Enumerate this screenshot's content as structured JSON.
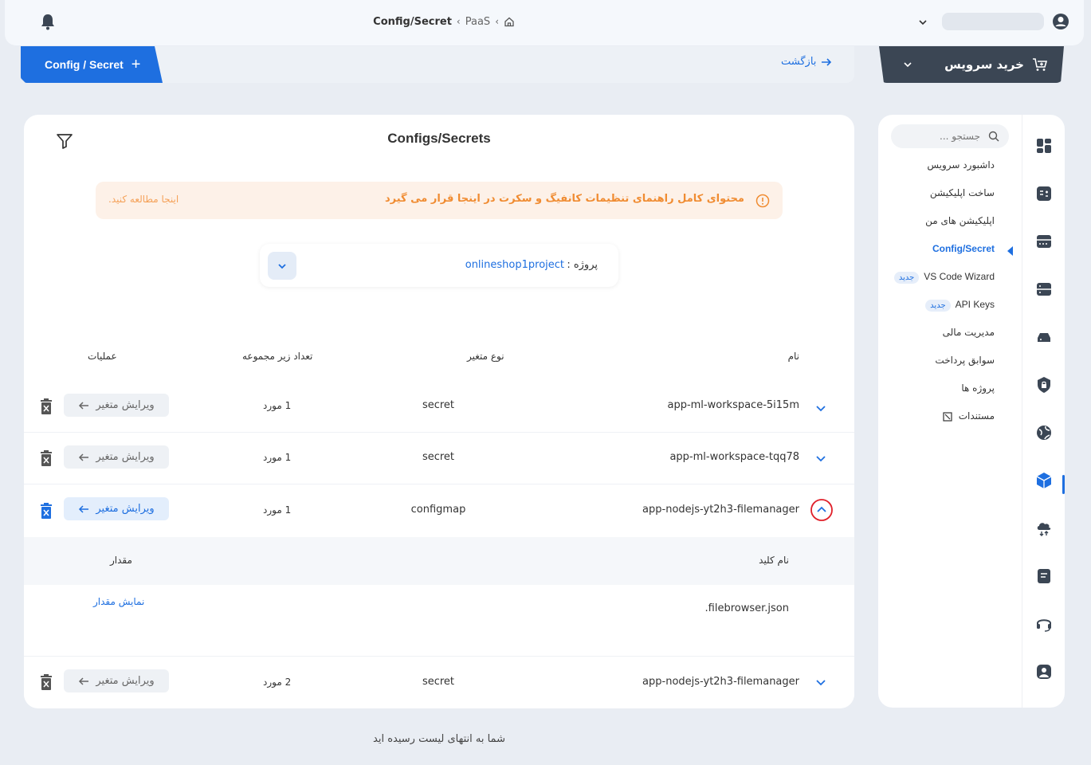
{
  "topbar": {
    "breadcrumbs": [
      "PaaS",
      "Config/Secret"
    ]
  },
  "subbar": {
    "config_tab_label": "Config / Secret",
    "back_label": "بازگشت",
    "buy_label": "خرید سرویس"
  },
  "card": {
    "title": "Configs/Secrets",
    "alert_message": "محتوای کامل راهنمای تنظیمات کانفیگ و سکرت در اینجا قرار می گیرد",
    "alert_link": "اینجا مطالعه کنید.",
    "project_label": "پروژه :",
    "project_value": "onlineshop1project",
    "columns": {
      "name": "نام",
      "type": "نوع متغیر",
      "count": "تعداد زیر مجموعه",
      "ops": "عملیات"
    },
    "edit_label": "ویرایش متغیر",
    "rows": [
      {
        "name": "app-ml-workspace-5i15m",
        "type": "secret",
        "count": "1 مورد"
      },
      {
        "name": "app-ml-workspace-tqq78",
        "type": "secret",
        "count": "1 مورد"
      },
      {
        "name": "app-nodejs-yt2h3-filemanager",
        "type": "configmap",
        "count": "1 مورد"
      },
      {
        "name": "app-nodejs-yt2h3-filemanager",
        "type": "secret",
        "count": "2 مورد"
      }
    ],
    "sub_table": {
      "key_header": "نام کلید",
      "value_header": "مقدار",
      "key": ".filebrowser.json",
      "show_value": "نمایش مقدار"
    }
  },
  "end_text": "شما به انتهای لیست رسیده اید",
  "sidebar": {
    "search_placeholder": "جستجو ...",
    "items": [
      {
        "label": "داشبورد سرویس"
      },
      {
        "label": "ساخت اپلیکیشن"
      },
      {
        "label": "اپلیکیشن های من"
      },
      {
        "label": "Config/Secret"
      },
      {
        "label": "VS Code Wizard",
        "badge": "جدید"
      },
      {
        "label": "API Keys",
        "badge": "جدید"
      },
      {
        "label": "مدیریت مالی"
      },
      {
        "label": "سوابق پرداخت"
      },
      {
        "label": "پروژه ها"
      },
      {
        "label": "مستندات"
      }
    ]
  },
  "colors": {
    "accent": "#1e6fe0",
    "dark": "#3b4654",
    "alert_bg": "#fdf1e8",
    "alert_text": "#f08c32",
    "highlight": "#e0202a"
  }
}
